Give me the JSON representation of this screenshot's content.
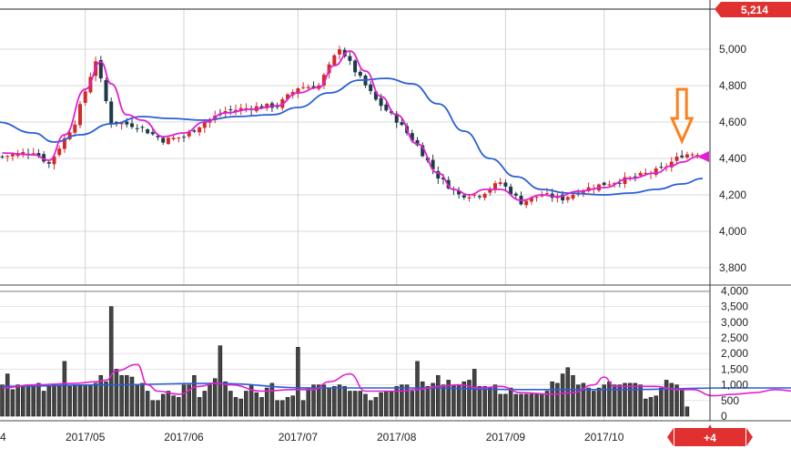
{
  "chart_data": [
    {
      "type": "candlestick",
      "panel": "price",
      "ylim": [
        3700,
        5200
      ],
      "yticks": [
        "5,000",
        "4,800",
        "4,600",
        "4,400",
        "4,200",
        "4,000",
        "3,800"
      ],
      "ytick_values": [
        5000,
        4800,
        4600,
        4400,
        4200,
        4000,
        3800
      ],
      "last_price_badge": "5,214",
      "current_price_marker": 4410,
      "annotation_arrow": "down-arrow",
      "annotation_arrow_index": 131,
      "colors": {
        "up": "#d42a2a",
        "down": "#1e3a48",
        "ma_short": "#e020d0",
        "ma_long": "#2a5fd6",
        "badge": "#e03030",
        "arrow": "#ff7f1e"
      },
      "x_labels": [
        "4",
        "2017/05",
        "2017/06",
        "2017/07",
        "2017/08",
        "2017/09",
        "2017/10"
      ],
      "x_label_index": [
        0,
        16,
        35,
        57,
        76,
        97,
        116
      ],
      "close_path": [
        [
          0,
          4410
        ],
        [
          6,
          4440
        ],
        [
          9,
          4370
        ],
        [
          14,
          4600
        ],
        [
          18,
          4940
        ],
        [
          21,
          4600
        ],
        [
          26,
          4580
        ],
        [
          31,
          4500
        ],
        [
          35,
          4520
        ],
        [
          39,
          4600
        ],
        [
          43,
          4660
        ],
        [
          48,
          4680
        ],
        [
          53,
          4690
        ],
        [
          57,
          4790
        ],
        [
          61,
          4800
        ],
        [
          65,
          5010
        ],
        [
          68,
          4880
        ],
        [
          72,
          4720
        ],
        [
          76,
          4610
        ],
        [
          80,
          4470
        ],
        [
          84,
          4300
        ],
        [
          88,
          4200
        ],
        [
          92,
          4200
        ],
        [
          96,
          4270
        ],
        [
          100,
          4160
        ],
        [
          104,
          4200
        ],
        [
          108,
          4180
        ],
        [
          112,
          4230
        ],
        [
          116,
          4260
        ],
        [
          121,
          4290
        ],
        [
          127,
          4340
        ],
        [
          131,
          4420
        ],
        [
          134,
          4430
        ]
      ],
      "ma_short": [
        [
          0,
          4430
        ],
        [
          6,
          4420
        ],
        [
          9,
          4390
        ],
        [
          12,
          4530
        ],
        [
          16,
          4780
        ],
        [
          19,
          4930
        ],
        [
          21,
          4810
        ],
        [
          24,
          4640
        ],
        [
          27,
          4610
        ],
        [
          31,
          4520
        ],
        [
          35,
          4540
        ],
        [
          39,
          4600
        ],
        [
          43,
          4650
        ],
        [
          48,
          4670
        ],
        [
          53,
          4690
        ],
        [
          57,
          4760
        ],
        [
          61,
          4790
        ],
        [
          64,
          4910
        ],
        [
          67,
          4990
        ],
        [
          70,
          4880
        ],
        [
          73,
          4740
        ],
        [
          76,
          4640
        ],
        [
          80,
          4480
        ],
        [
          84,
          4320
        ],
        [
          87,
          4230
        ],
        [
          90,
          4200
        ],
        [
          93,
          4230
        ],
        [
          96,
          4230
        ],
        [
          100,
          4170
        ],
        [
          104,
          4200
        ],
        [
          107,
          4190
        ],
        [
          111,
          4220
        ],
        [
          116,
          4240
        ],
        [
          121,
          4290
        ],
        [
          126,
          4320
        ],
        [
          129,
          4360
        ],
        [
          131,
          4380
        ],
        [
          134,
          4410
        ]
      ],
      "ma_long": [
        [
          -1,
          4600
        ],
        [
          6,
          4540
        ],
        [
          10,
          4490
        ],
        [
          15,
          4530
        ],
        [
          21,
          4590
        ],
        [
          27,
          4630
        ],
        [
          32,
          4620
        ],
        [
          39,
          4610
        ],
        [
          45,
          4630
        ],
        [
          52,
          4640
        ],
        [
          57,
          4680
        ],
        [
          63,
          4760
        ],
        [
          69,
          4830
        ],
        [
          74,
          4840
        ],
        [
          79,
          4810
        ],
        [
          84,
          4700
        ],
        [
          89,
          4550
        ],
        [
          94,
          4400
        ],
        [
          99,
          4300
        ],
        [
          104,
          4230
        ],
        [
          109,
          4210
        ],
        [
          116,
          4200
        ],
        [
          121,
          4210
        ],
        [
          126,
          4230
        ],
        [
          131,
          4260
        ],
        [
          135,
          4290
        ]
      ]
    },
    {
      "type": "bar",
      "panel": "volume",
      "ylim": [
        0,
        4000
      ],
      "yticks": [
        "4,000",
        "3,500",
        "3,000",
        "2,500",
        "2,000",
        "1,500",
        "1,000",
        "500",
        "0"
      ],
      "ytick_values": [
        4000,
        3500,
        3000,
        2500,
        2000,
        1500,
        1000,
        500,
        0
      ],
      "values": [
        1000,
        1350,
        850,
        1000,
        950,
        1000,
        1000,
        1050,
        800,
        950,
        1000,
        1000,
        1750,
        950,
        1000,
        1000,
        1000,
        1000,
        1050,
        1300,
        1100,
        3500,
        1500,
        1300,
        1300,
        1250,
        1000,
        1050,
        800,
        500,
        500,
        700,
        800,
        650,
        600,
        1000,
        1000,
        1300,
        600,
        800,
        1000,
        1200,
        2250,
        1100,
        800,
        600,
        550,
        800,
        1000,
        750,
        600,
        900,
        1050,
        500,
        500,
        600,
        650,
        2200,
        500,
        900,
        1000,
        1000,
        1000,
        900,
        950,
        1000,
        950,
        800,
        800,
        800,
        700,
        500,
        600,
        750,
        800,
        800,
        950,
        1000,
        1000,
        800,
        1750,
        1100,
        950,
        1050,
        1300,
        1000,
        1150,
        1000,
        1000,
        1100,
        1150,
        1500,
        950,
        950,
        900,
        1000,
        700,
        700,
        900,
        700,
        700,
        700,
        700,
        700,
        700,
        800,
        1100,
        1050,
        1350,
        1550,
        1300,
        1000,
        1050,
        900,
        800,
        900,
        1000,
        1100,
        1000,
        1000,
        1050,
        1050,
        1050,
        1000,
        550,
        600,
        650,
        900,
        1150,
        1050,
        1000,
        850,
        300
      ],
      "ma_short": [
        [
          0,
          900
        ],
        [
          6,
          1000
        ],
        [
          14,
          1050
        ],
        [
          18,
          1100
        ],
        [
          20,
          1150
        ],
        [
          22,
          1450
        ],
        [
          26,
          1650
        ],
        [
          28,
          1000
        ],
        [
          30,
          800
        ],
        [
          34,
          700
        ],
        [
          38,
          950
        ],
        [
          41,
          1050
        ],
        [
          44,
          1000
        ],
        [
          50,
          800
        ],
        [
          56,
          850
        ],
        [
          60,
          850
        ],
        [
          63,
          1100
        ],
        [
          67,
          1350
        ],
        [
          70,
          800
        ],
        [
          76,
          800
        ],
        [
          80,
          850
        ],
        [
          84,
          950
        ],
        [
          88,
          1000
        ],
        [
          92,
          900
        ],
        [
          96,
          950
        ],
        [
          100,
          750
        ],
        [
          106,
          700
        ],
        [
          110,
          750
        ],
        [
          114,
          1000
        ],
        [
          116,
          1250
        ],
        [
          118,
          950
        ],
        [
          122,
          950
        ],
        [
          126,
          950
        ],
        [
          130,
          850
        ],
        [
          133,
          850
        ],
        [
          137,
          650
        ],
        [
          141,
          700
        ],
        [
          145,
          750
        ],
        [
          149,
          850
        ],
        [
          153,
          800
        ]
      ],
      "ma_long": [
        [
          0,
          950
        ],
        [
          20,
          1000
        ],
        [
          40,
          1050
        ],
        [
          60,
          900
        ],
        [
          80,
          900
        ],
        [
          100,
          850
        ],
        [
          120,
          850
        ],
        [
          140,
          900
        ],
        [
          153,
          900
        ]
      ]
    }
  ]
}
